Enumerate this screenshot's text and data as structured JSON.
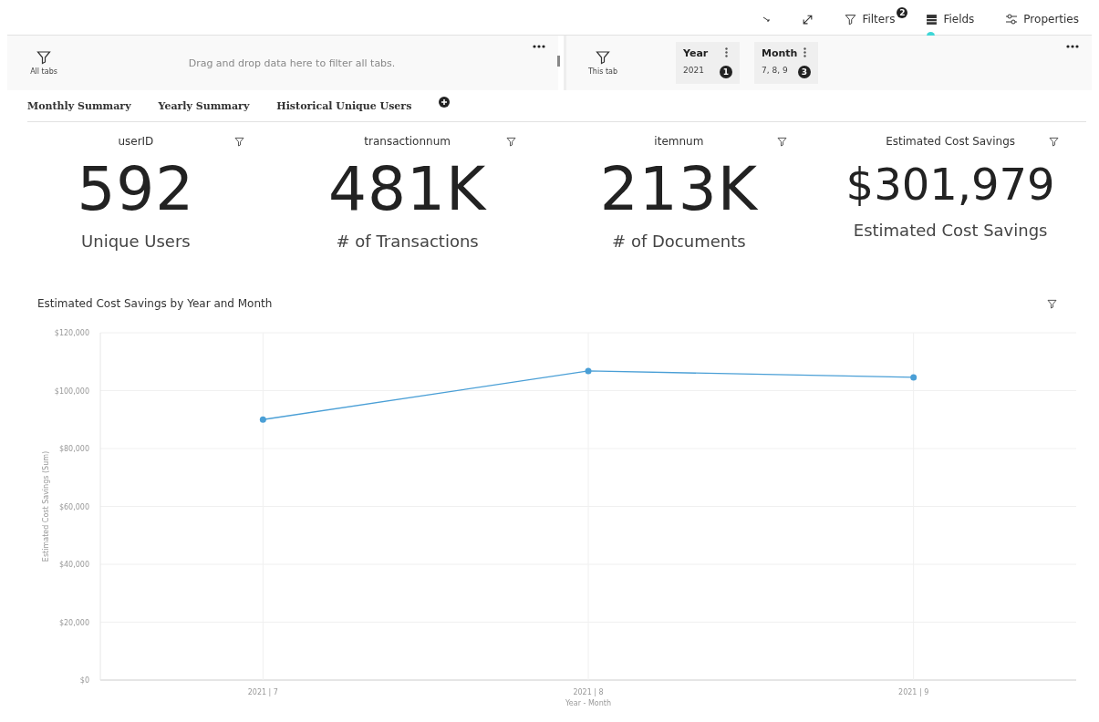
{
  "toolbar": {
    "items": [
      {
        "kind": "collapse"
      },
      {
        "kind": "expand"
      },
      {
        "kind": "filters",
        "label": "Filters",
        "badge": "2"
      },
      {
        "kind": "fields",
        "label": "Fields"
      },
      {
        "kind": "properties",
        "label": "Properties"
      }
    ]
  },
  "filter_bar": {
    "all_tabs": {
      "label": "All tabs",
      "hint": "Drag and drop data here to filter all tabs."
    },
    "this_tab": {
      "label": "This tab",
      "filters": [
        {
          "name": "Year",
          "value": "2021",
          "count": "1"
        },
        {
          "name": "Month",
          "value": "7, 8, 9",
          "count": "3"
        }
      ]
    }
  },
  "tabs": [
    {
      "label": "Monthly Summary"
    },
    {
      "label": "Yearly Summary"
    },
    {
      "label": "Historical Unique Users"
    }
  ],
  "kpis": [
    {
      "heading": "userID",
      "value": "592",
      "caption": "Unique Users"
    },
    {
      "heading": "transactionnum",
      "value": "481K",
      "caption": "# of Transactions"
    },
    {
      "heading": "itemnum",
      "value": "213K",
      "caption": "# of Documents"
    },
    {
      "heading": "Estimated Cost Savings",
      "value": "$301,979",
      "caption": "Estimated Cost Savings"
    }
  ],
  "chart": {
    "title": "Estimated Cost Savings by Year and Month",
    "chart_data": {
      "type": "line",
      "xlabel": "Year - Month",
      "ylabel": "Estimated Cost Savings (Sum)",
      "categories": [
        "2021 | 7",
        "2021 | 8",
        "2021 | 9"
      ],
      "grid": true,
      "series": [
        {
          "color": "#4a9fd6",
          "marker": true,
          "values": [
            90000,
            106800,
            104600
          ]
        }
      ],
      "ylim": [
        0,
        120000
      ],
      "yticks": [
        {
          "value": 0,
          "label": "$0"
        },
        {
          "value": 20000,
          "label": "$20,000"
        },
        {
          "value": 40000,
          "label": "$40,000"
        },
        {
          "value": 60000,
          "label": "$60,000"
        },
        {
          "value": 80000,
          "label": "$80,000"
        },
        {
          "value": 100000,
          "label": "$100,000"
        },
        {
          "value": 120000,
          "label": "$120,000"
        }
      ]
    }
  }
}
